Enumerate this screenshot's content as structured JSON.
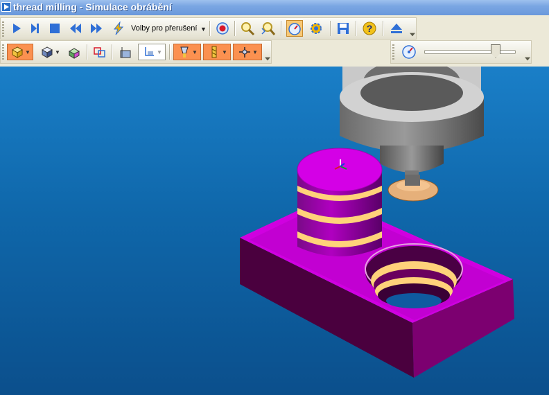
{
  "window": {
    "title": "thread milling - Simulace obrábění"
  },
  "toolbar_main": {
    "play_label": "play-icon",
    "interrupt_options_label": "Volby pro přerušení"
  },
  "toolbar_view": {},
  "speed": {
    "level": 0.78
  },
  "colors": {
    "part": "#b800c8",
    "thread": "#ffd27a",
    "tool": "#8a8a8a",
    "background": "#0f67aa"
  }
}
